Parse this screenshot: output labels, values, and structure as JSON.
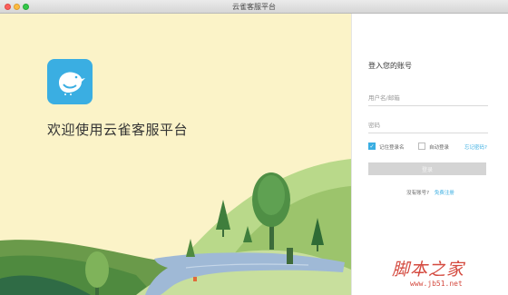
{
  "window": {
    "title": "云雀客服平台"
  },
  "welcome": {
    "heading": "欢迎使用云雀客服平台",
    "logo_icon": "bird-icon",
    "logo_color": "#3aaee2"
  },
  "login": {
    "title": "登入您的账号",
    "username_placeholder": "用户名/邮箱",
    "password_placeholder": "密码",
    "remember_label": "记住登录名",
    "remember_checked": true,
    "auto_login_label": "自动登录",
    "auto_login_checked": false,
    "forgot_link": "忘记密码?",
    "submit_label": "登录",
    "register_question": "没有账号?",
    "register_link": "免费注册"
  },
  "watermark": {
    "text": "脚本之家",
    "url": "www.jb51.net"
  },
  "colors": {
    "accent": "#3aaee2",
    "background": "#fbf3c8",
    "watermark": "#d44a3f"
  }
}
